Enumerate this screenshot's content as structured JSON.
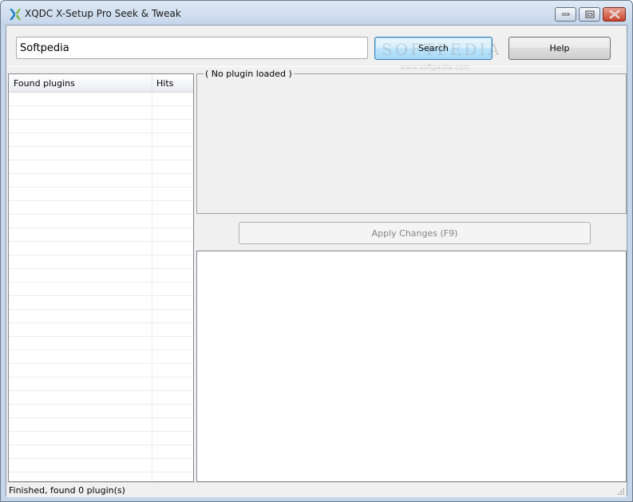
{
  "window": {
    "title": "XQDC X-Setup Pro Seek & Tweak",
    "icon": "xqdc-logo-icon"
  },
  "caption_buttons": {
    "minimize": "minimize-icon",
    "maximize": "maximize-icon",
    "close": "close-icon"
  },
  "search": {
    "value": "Softpedia",
    "button_label": "Search"
  },
  "help": {
    "button_label": "Help"
  },
  "watermark": {
    "text": "SOFTPEDIA",
    "url": "www.softpedia.com"
  },
  "plugins_list": {
    "columns": [
      "Found plugins",
      "Hits"
    ],
    "rows": []
  },
  "plugin_group": {
    "legend": "( No plugin loaded )"
  },
  "apply": {
    "button_label": "Apply Changes (F9)",
    "enabled": false
  },
  "status": {
    "text": "Finished, found 0 plugin(s)"
  },
  "colors": {
    "title_bar": "#c6d6ea",
    "client_bg": "#f0f0f0",
    "close_button": "#c7432c",
    "search_focus_border": "#3c7fb1",
    "disabled_text": "#838383"
  }
}
